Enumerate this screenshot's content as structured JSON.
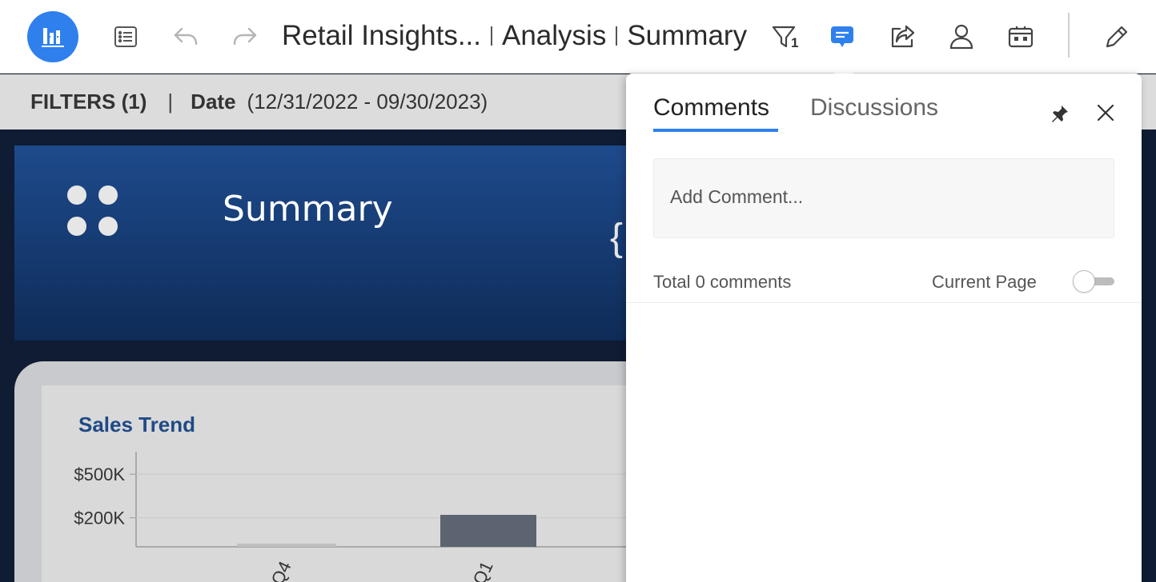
{
  "toolbar": {
    "breadcrumbs": [
      "Retail Insights...",
      "Analysis",
      "Summary"
    ],
    "filter_count_badge": "1",
    "icons": {
      "logo": "dashboard-logo-icon",
      "toc": "list-icon",
      "undo": "undo-icon",
      "redo": "redo-icon",
      "filter": "filter-icon",
      "comments": "comment-icon",
      "share": "share-icon",
      "user": "user-icon",
      "present": "presentation-icon",
      "edit": "pencil-icon"
    },
    "accent_color": "#2f80ed"
  },
  "filterbar": {
    "title": "FILTERS (1)",
    "separator": "|",
    "label": "Date",
    "value": "(12/31/2022 - 09/30/2023)"
  },
  "canvas": {
    "banner_title": "Summary",
    "brace_glyph": "{",
    "chart_title": "Sales Trend"
  },
  "chart_data": {
    "type": "bar",
    "title": "Sales Trend",
    "categories": [
      "Q4",
      "Q1"
    ],
    "values": [
      10000,
      220000
    ],
    "y_ticks": [
      "$500K",
      "$200K"
    ],
    "ylim": [
      0,
      600000
    ],
    "bar_colors": [
      "#bfbfbf",
      "#5b6470"
    ]
  },
  "panel": {
    "tabs": [
      "Comments",
      "Discussions"
    ],
    "active_tab": "Comments",
    "add_comment_placeholder": "Add Comment...",
    "total_comments": "Total 0 comments",
    "current_page_label": "Current Page",
    "current_page_toggle": false
  }
}
